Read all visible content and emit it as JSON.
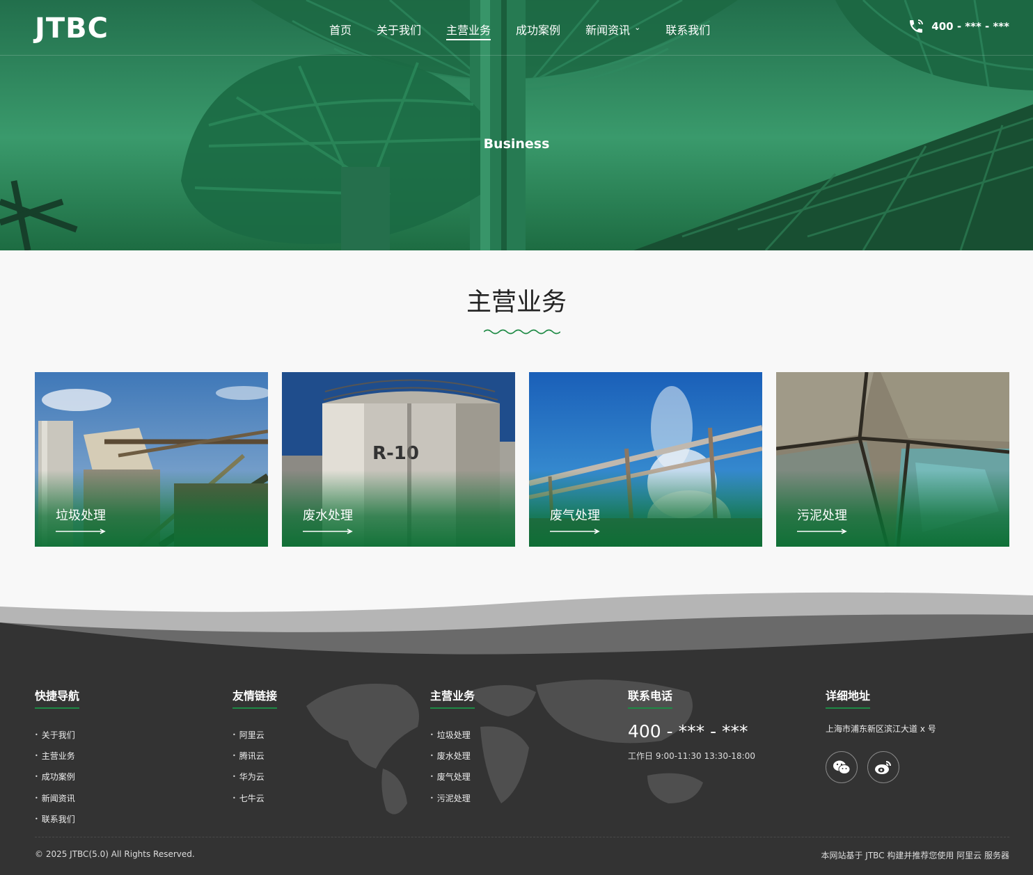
{
  "header": {
    "logo": "JTBC",
    "nav": [
      {
        "label": "首页",
        "active": false
      },
      {
        "label": "关于我们",
        "active": false
      },
      {
        "label": "主营业务",
        "active": true
      },
      {
        "label": "成功案例",
        "active": false
      },
      {
        "label": "新闻资讯",
        "active": false,
        "has_dropdown": true
      },
      {
        "label": "联系我们",
        "active": false
      }
    ],
    "phone": "400 - *** - ***",
    "phone_icon": "phone-icon"
  },
  "hero": {
    "title": "Business"
  },
  "main": {
    "section_title": "主营业务",
    "cards": [
      {
        "label": "垃圾处理"
      },
      {
        "label": "废水处理"
      },
      {
        "label": "废气处理"
      },
      {
        "label": "污泥处理"
      }
    ]
  },
  "footer": {
    "quick_nav": {
      "title": "快捷导航",
      "items": [
        "关于我们",
        "主营业务",
        "成功案例",
        "新闻资讯",
        "联系我们"
      ]
    },
    "friend_links": {
      "title": "友情链接",
      "items": [
        "阿里云",
        "腾讯云",
        "华为云",
        "七牛云"
      ]
    },
    "business": {
      "title": "主营业务",
      "items": [
        "垃圾处理",
        "废水处理",
        "废气处理",
        "污泥处理"
      ]
    },
    "contact": {
      "title": "联系电话",
      "phone": "400 - *** - ***",
      "hours": "工作日 9:00-11:30 13:30-18:00"
    },
    "address": {
      "title": "详细地址",
      "text": "上海市浦东新区滨江大道 x 号",
      "socials": [
        "wechat-icon",
        "weibo-icon"
      ]
    },
    "copyright": "© 2025 JTBC(5.0) All Rights Reserved.",
    "credits": "本网站基于 JTBC 构建并推荐您使用 阿里云 服务器"
  },
  "colors": {
    "accent": "#1e8a45",
    "footer_bg": "#333333",
    "hero_green": "#1f6f4a"
  }
}
